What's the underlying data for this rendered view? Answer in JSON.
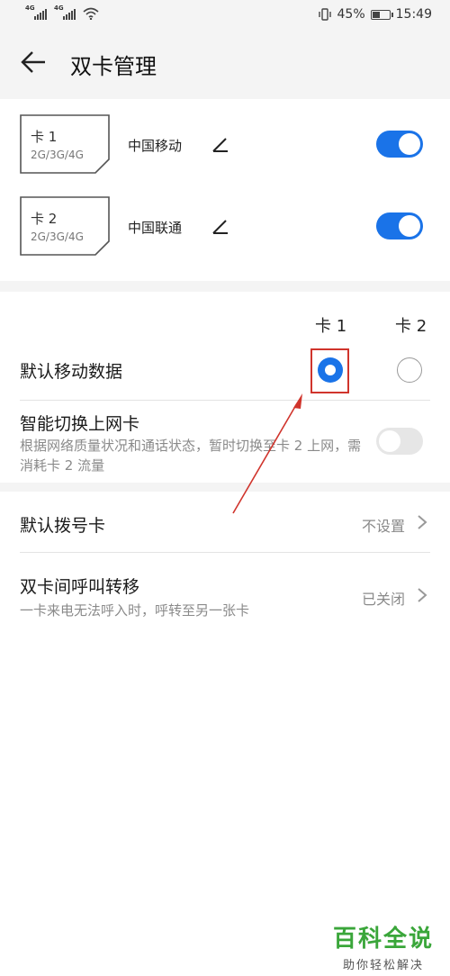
{
  "status_bar": {
    "signal_1_label": "4G",
    "signal_2_label": "4G",
    "battery_percent": "45%",
    "battery_level": 0.45,
    "time": "15:49"
  },
  "header": {
    "title": "双卡管理"
  },
  "sim_cards": [
    {
      "name": "卡 1",
      "network": "2G/3G/4G",
      "carrier": "中国移动",
      "enabled": true
    },
    {
      "name": "卡 2",
      "network": "2G/3G/4G",
      "carrier": "中国联通",
      "enabled": true
    }
  ],
  "data_section": {
    "col_sim1": "卡 1",
    "col_sim2": "卡 2",
    "default_data_label": "默认移动数据",
    "selected_sim": 1,
    "smart_switch_label": "智能切换上网卡",
    "smart_switch_desc": "根据网络质量状况和通话状态，暂时切换至卡 2 上网，需消耗卡 2 流量",
    "smart_switch_enabled": false
  },
  "call_section": {
    "default_dial_label": "默认拨号卡",
    "default_dial_value": "不设置",
    "forward_label": "双卡间呼叫转移",
    "forward_desc": "一卡来电无法呼入时，呼转至另一张卡",
    "forward_value": "已关闭"
  },
  "watermark": {
    "title": "百科全说",
    "subtitle": "助你轻松解决"
  },
  "colors": {
    "accent": "#1a73e8",
    "annotation": "#d0342c",
    "watermark": "#3aa63a"
  }
}
